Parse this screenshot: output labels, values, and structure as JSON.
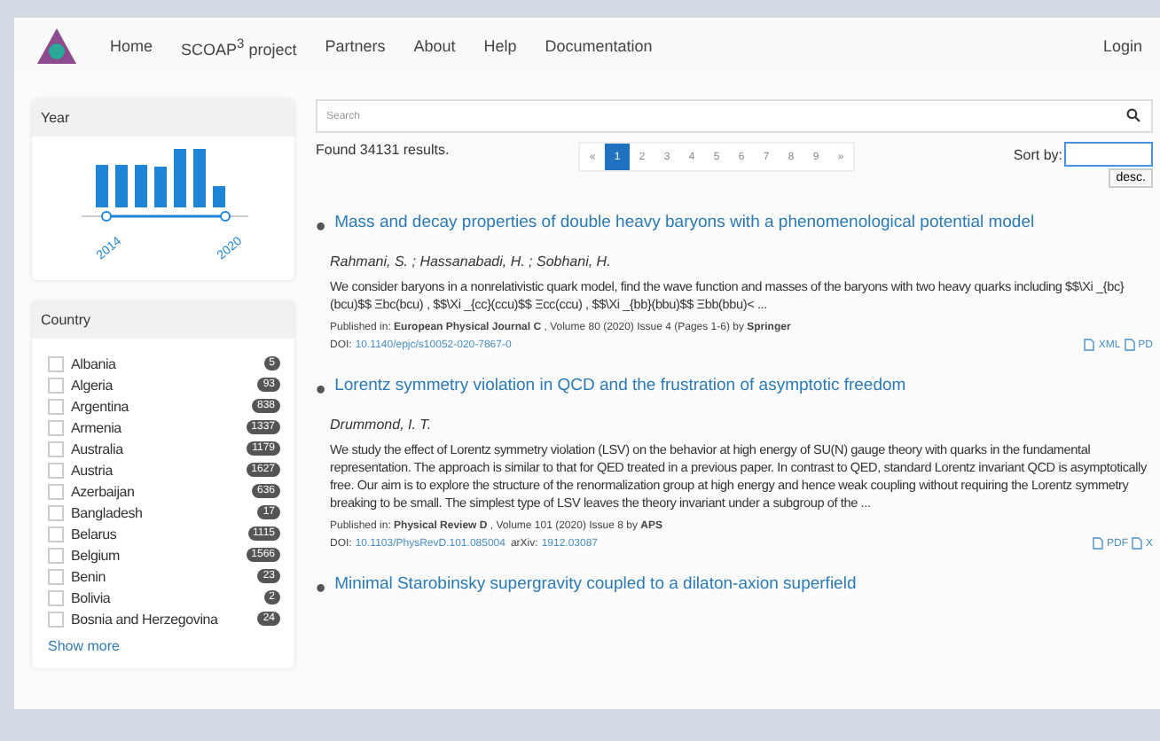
{
  "nav": {
    "items": [
      "Home",
      "SCOAP$^{3}$ project",
      "Partners",
      "About",
      "Help",
      "Documentation"
    ],
    "login": "Login"
  },
  "year_facet": {
    "title": "Year",
    "from": "2014",
    "to": "2020"
  },
  "country_facet": {
    "title": "Country",
    "show_more": "Show more",
    "items": [
      {
        "name": "Albania",
        "count": "5",
        "checked": false
      },
      {
        "name": "Algeria",
        "count": "93",
        "checked": false
      },
      {
        "name": "Argentina",
        "count": "838",
        "checked": false
      },
      {
        "name": "Armenia",
        "count": "1337",
        "checked": false
      },
      {
        "name": "Australia",
        "count": "1179",
        "checked": false
      },
      {
        "name": "Austria",
        "count": "1627",
        "checked": false
      },
      {
        "name": "Azerbaijan",
        "count": "636",
        "checked": false
      },
      {
        "name": "Bangladesh",
        "count": "17",
        "checked": false
      },
      {
        "name": "Belarus",
        "count": "1115",
        "checked": false
      },
      {
        "name": "Belgium",
        "count": "1566",
        "checked": false
      },
      {
        "name": "Benin",
        "count": "23",
        "checked": false
      },
      {
        "name": "Bolivia",
        "count": "2",
        "checked": false
      },
      {
        "name": "Bosnia and Herzegovina",
        "count": "24",
        "checked": false
      }
    ]
  },
  "search": {
    "placeholder": "Search"
  },
  "found": "Found 34131 results.",
  "pagination": [
    {
      "label": "«",
      "selected": false
    },
    {
      "label": "1",
      "selected": true
    },
    {
      "label": "2",
      "selected": false
    },
    {
      "label": "3",
      "selected": false
    },
    {
      "label": "4",
      "selected": false
    },
    {
      "label": "5",
      "selected": false
    },
    {
      "label": "6",
      "selected": false
    },
    {
      "label": "7",
      "selected": false
    },
    {
      "label": "8",
      "selected": false
    },
    {
      "label": "9",
      "selected": false
    },
    {
      "label": "»",
      "selected": false
    }
  ],
  "sort": {
    "label": "Sort by:",
    "order": "desc."
  },
  "results": [
    {
      "bullet": "•",
      "title": "Mass and decay properties of double heavy baryons with a phenomenological potential model",
      "authors": "Rahmani, S. ; Hassanabadi, H. ; Sobhani, H.",
      "abstract": "We consider baryons in a nonrelativistic quark model, find the wave function and masses of the baryons with two heavy quarks including $$\\Xi _{bc}(bcu)$$ Ξbc(bcu) , $$\\Xi _{cc}(ccu)$$ Ξcc(ccu) , $$\\Xi _{bb}(bbu)$$ Ξbb(bbu)< ...",
      "published": "Published in: **European Physical Journal C** , Volume 80 (2020) Issue 4 (Pages 1-6) by **Springer**",
      "doi_label": "DOI:",
      "doi": "10.1140/epjc/s10052-020-7867-0",
      "files": [
        "XML",
        "PD"
      ]
    },
    {
      "bullet": "•",
      "title": "Lorentz symmetry violation in QCD and the frustration of asymptotic freedom",
      "authors": "Drummond, I. T.",
      "abstract": "We study the effect of Lorentz symmetry violation (LSV) on the behavior at high energy of SU(N) gauge theory with quarks in the fundamental representation. The approach is similar to that for QED treated in a previous paper. In contrast to QED, standard Lorentz invariant QCD is asymptotically free. Our aim is to explore the structure of the renormalization group at high energy and hence weak coupling without requiring the Lorentz symmetry breaking to be small. The simplest type of LSV leaves the theory invariant under a subgroup of the ...",
      "published": "Published in: **Physical Review D** , Volume 101 (2020) Issue 8 by **APS**",
      "doi_label": "DOI:",
      "doi": "10.1103/PhysRevD.101.085004",
      "arxiv_label": "arXiv:",
      "arxiv": "1912.03087",
      "files": [
        "PDF",
        "X"
      ]
    },
    {
      "bullet": "•",
      "title": "Minimal Starobinsky supergravity coupled to a dilaton-axion superfield"
    }
  ]
}
